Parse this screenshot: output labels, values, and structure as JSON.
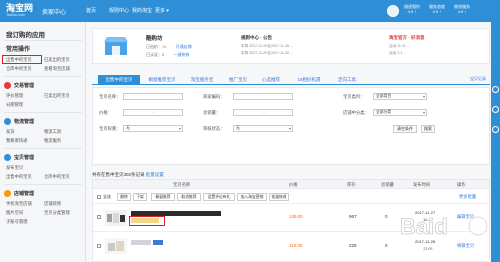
{
  "header": {
    "logo_main": "淘宝网",
    "logo_sub": "Taobao.com",
    "title": "卖家中心",
    "nav": [
      "首页",
      "规则中心",
      "我的淘宝",
      "更多 ▾"
    ],
    "scores": [
      {
        "label": "描述相符",
        "value": "4.9 ↑"
      },
      {
        "label": "服务态度",
        "value": "4.9 ↑"
      },
      {
        "label": "物流服务",
        "value": "4.9 ↑"
      }
    ]
  },
  "sidebar": {
    "title": "我订购的应用",
    "common_section": "常用操作",
    "common_items": [
      "出售中的宝贝",
      "已卖出的宝贝",
      "仓库中的宝贝",
      "查看淘宝店铺"
    ],
    "sections": [
      {
        "name": "交易管理",
        "items": [
          "评价管理",
          "已卖出的宝贝",
          "分期管理"
        ]
      },
      {
        "name": "物流管理",
        "items": [
          "发货",
          "物流工具",
          "我要寄快递",
          "物流服务"
        ]
      },
      {
        "name": "宝贝管理",
        "items": [
          "发布宝贝",
          "出售中的宝贝",
          "仓库中的宝贝"
        ]
      },
      {
        "name": "店铺管理",
        "items": [
          "手机淘宝店铺",
          "店铺装修",
          "图片空间",
          "宝贝分类管理",
          "子账号管理"
        ]
      }
    ]
  },
  "shop": {
    "name": "酷购坊",
    "line1_label": "已出价：",
    "line1_value": "10",
    "line1_link": "开通店铺",
    "line2_label": "已认证：",
    "line2_value": "8",
    "line2_link": "一键装修"
  },
  "notices": {
    "rules_title": "规则中心 · 公告",
    "rules_lines": [
      "本周 2017-11-20至2017-11-26 ...",
      "本周 2017-11-20至2017-11-26 ..."
    ],
    "promo_title": "淘宝官方 · 好消息",
    "promo_lines": [
      "活动 11·11 ...",
      "活动 1·1 ..."
    ]
  },
  "tabs": {
    "items": [
      "出售中的宝贝",
      "橱窗推荐宝贝",
      "淘宝服务宝",
      "推广宝贝",
      "心选推荐",
      "16相好机遇",
      "定向工具"
    ],
    "right_link": "宝贝记录"
  },
  "filters": {
    "fields": [
      {
        "label": "宝贝名称：",
        "value": ""
      },
      {
        "label": "商家编码：",
        "value": ""
      },
      {
        "label": "宝贝类目：",
        "value": "全部类目"
      },
      {
        "label": "价格：",
        "value": "-"
      },
      {
        "label": "总销量：",
        "value": "-"
      },
      {
        "label": "店铺中分类：",
        "value": "全部分类"
      },
      {
        "label": "宝贝权重：",
        "value": "无"
      },
      {
        "label": "审核状态：",
        "value": "无"
      }
    ],
    "clear_label": "清空条件",
    "search_label": "搜索"
  },
  "table": {
    "count_prefix": "共有在售中宝贝302条记录 ",
    "count_link": "批量设置",
    "headers": [
      "宝贝名称",
      "价格",
      "库存",
      "总销量",
      "发布时间",
      "操作"
    ],
    "actions": [
      "全选",
      "删除",
      "下架",
      "橱窗推荐",
      "取消推荐",
      "设置评论有礼",
      "加入淘宝营销",
      "批量修改",
      "更多批量"
    ],
    "rows": [
      {
        "price": "139.00",
        "stock": "967",
        "sales": "0",
        "date": "2017-11-27",
        "time": "11:..",
        "op": "编辑宝贝"
      },
      {
        "price": "110.00",
        "stock": "229",
        "sales": "0",
        "date": "2017-11-28",
        "time": "22:01",
        "op": "编辑宝贝"
      }
    ]
  }
}
